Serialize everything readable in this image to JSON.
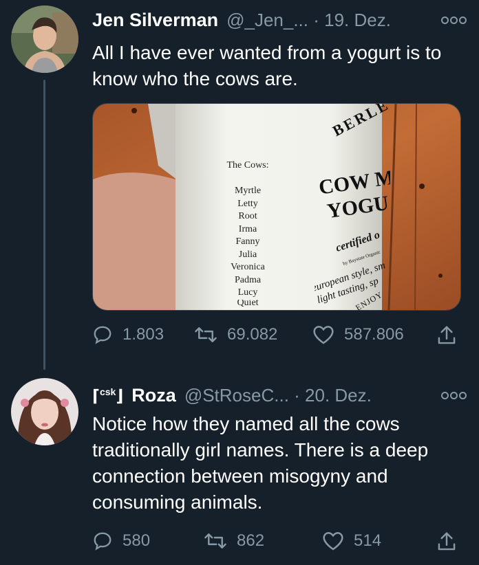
{
  "tweets": [
    {
      "name": "Jen Silverman",
      "handle": "@_Jen_... · 19. Dez.",
      "text": "All I have ever wanted from a yogurt is to know who the cows are.",
      "replies": "1.803",
      "retweets": "69.082",
      "likes": "587.806",
      "media": {
        "brand": "BERLE",
        "product_line1": "COW M",
        "product_line2": "YOGU",
        "certified": "certified o",
        "certified_by": "by Baystate Organic",
        "desc1": "european style, sm",
        "desc2": "light tasting, sp",
        "enjoy": "ENJOY",
        "cows_heading": "The Cows:",
        "cows": [
          "Myrtle",
          "Letty",
          "Root",
          "Irma",
          "Fanny",
          "Julia",
          "Veronica",
          "Padma",
          "Lucy",
          "Quiet"
        ]
      }
    },
    {
      "csk_prefix": "⌈",
      "csk_tag": "csk",
      "csk_suffix": "⌋",
      "name": "Roza",
      "handle": "@StRoseC... · 20. Dez.",
      "text": "Notice how they named all the cows traditionally girl names. There is a deep connection between misogyny and consuming animals.",
      "replies": "580",
      "retweets": "862",
      "likes": "514"
    }
  ],
  "colors": {
    "background": "#15202b",
    "secondary_text": "#8899a6",
    "thread_line": "#3d5466"
  },
  "icons": [
    "reply-icon",
    "retweet-icon",
    "like-icon",
    "share-icon",
    "more-icon"
  ]
}
